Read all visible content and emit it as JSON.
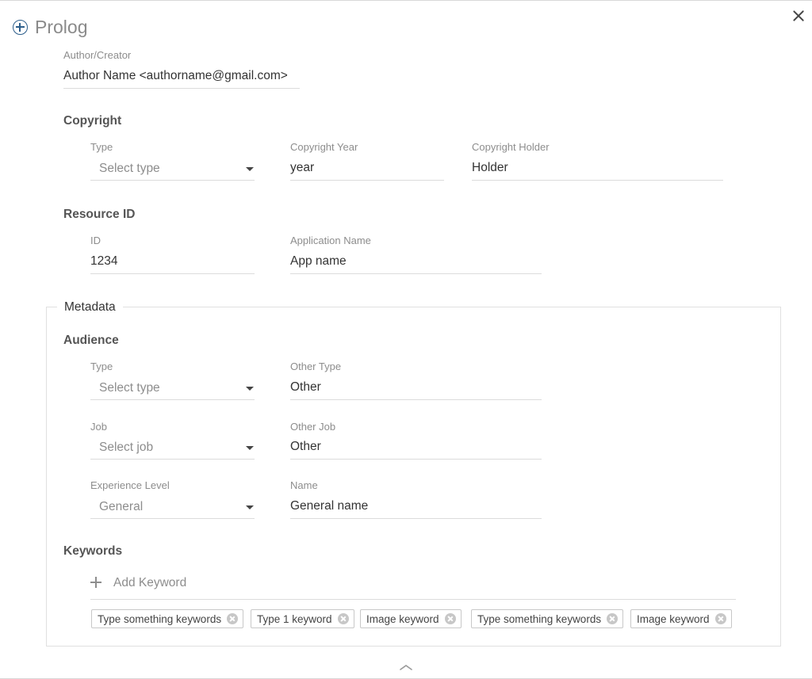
{
  "header": {
    "title": "Prolog"
  },
  "author": {
    "label": "Author/Creator",
    "value": "Author Name <authorname@gmail.com>"
  },
  "copyright": {
    "section_title": "Copyright",
    "type_label": "Type",
    "type_value": "Select type",
    "year_label": "Copyright Year",
    "year_value": "year",
    "holder_label": "Copyright Holder",
    "holder_value": "Holder"
  },
  "resource": {
    "section_title": "Resource ID",
    "id_label": "ID",
    "id_value": "1234",
    "app_label": "Application Name",
    "app_value": "App name"
  },
  "metadata": {
    "legend": "Metadata",
    "audience": {
      "section_title": "Audience",
      "type_label": "Type",
      "type_value": "Select type",
      "other_type_label": "Other Type",
      "other_type_value": "Other",
      "job_label": "Job",
      "job_value": "Select job",
      "other_job_label": "Other Job",
      "other_job_value": "Other",
      "experience_label": "Experience Level",
      "experience_value": "General",
      "name_label": "Name",
      "name_value": "General name"
    },
    "keywords": {
      "section_title": "Keywords",
      "add_placeholder": "Add Keyword",
      "items": [
        "Type something keywords",
        "Type 1 keyword",
        "Image keyword",
        "Type something keywords",
        "Image keyword"
      ]
    }
  },
  "colors": {
    "accent": "#2b5d8a",
    "line": "#dcdcdc",
    "label": "#8d8d8d"
  }
}
